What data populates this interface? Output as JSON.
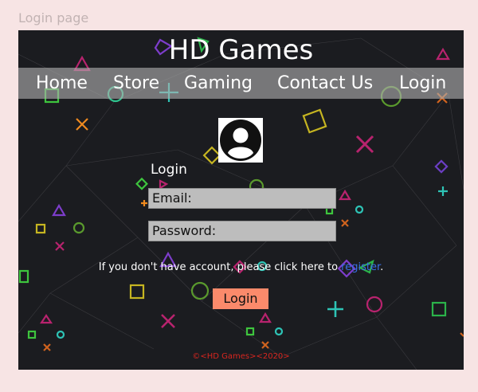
{
  "frame": {
    "label": "Login page"
  },
  "site": {
    "title": "HD Games"
  },
  "nav": {
    "items": [
      {
        "label": "Home"
      },
      {
        "label": "Store"
      },
      {
        "label": "Gaming"
      },
      {
        "label": "Contact Us"
      },
      {
        "label": "Login"
      }
    ]
  },
  "login_form": {
    "heading": "Login",
    "email_placeholder": "Email:",
    "password_placeholder": "Password:",
    "register_text": "If you don't have account, please click here to ",
    "register_link": "register",
    "register_suffix": ".",
    "submit_label": "Login"
  },
  "footer": {
    "copyright": "©<HD Games><2020>"
  },
  "colors": {
    "page_background": "#f7e4e4",
    "screen_background": "#1b1c20",
    "nav_bar": "#b0b0b0",
    "link": "#3a6fe6",
    "button": "#fb8a6b",
    "footer_text": "#d8261f"
  },
  "icons": {
    "avatar": "user-circle-icon",
    "background": "gamepad-shapes-pattern"
  }
}
